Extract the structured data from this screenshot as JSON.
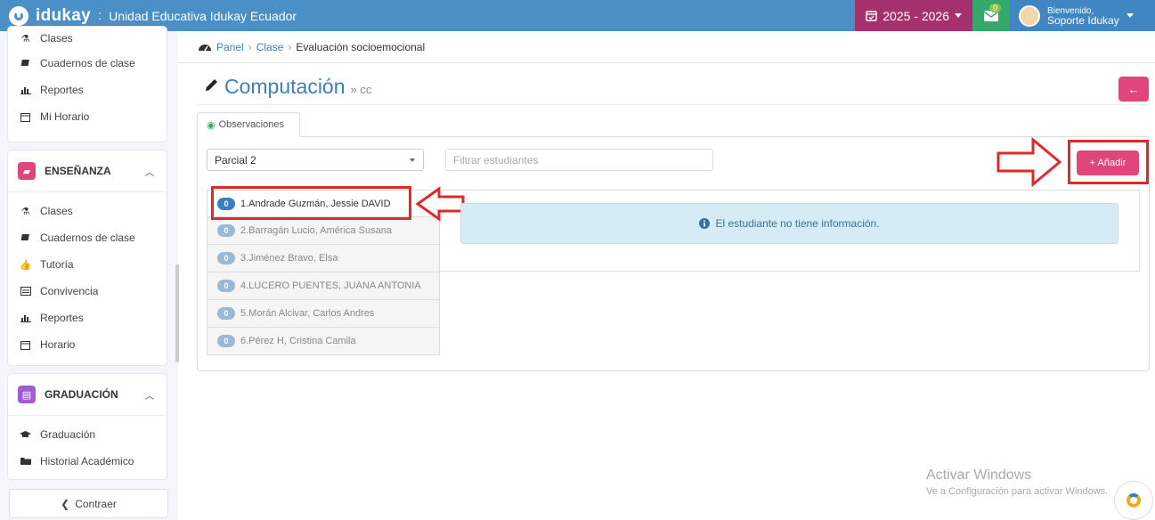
{
  "header": {
    "brand": "idukay",
    "separator": ":",
    "school": "Unidad Educativa Idukay Ecuador",
    "year": "2025 - 2026",
    "mail_count": "0",
    "welcome": "Bienvenido,",
    "user_name": "Soporte Idukay",
    "colors": {
      "bar": "#4a8fc6",
      "year": "#a5316e",
      "mail": "#35a96b"
    }
  },
  "sidebar": {
    "top_items": [
      {
        "label": "Clases",
        "icon": "flask-icon"
      },
      {
        "label": "Cuadernos de clase",
        "icon": "book-icon"
      },
      {
        "label": "Reportes",
        "icon": "bar-chart-icon"
      },
      {
        "label": "Mi Horario",
        "icon": "calendar-icon"
      }
    ],
    "sections": [
      {
        "title": "ENSEÑANZA",
        "color": "#e0467c",
        "items": [
          {
            "label": "Clases",
            "icon": "flask-icon"
          },
          {
            "label": "Cuadernos de clase",
            "icon": "book-icon"
          },
          {
            "label": "Tutoría",
            "icon": "thumbs-up-icon"
          },
          {
            "label": "Convivencia",
            "icon": "list-icon"
          },
          {
            "label": "Reportes",
            "icon": "bar-chart-icon"
          },
          {
            "label": "Horario",
            "icon": "calendar-icon"
          }
        ]
      },
      {
        "title": "GRADUACIÓN",
        "color": "#a25bd1",
        "items": [
          {
            "label": "Graduación",
            "icon": "graduation-cap-icon"
          },
          {
            "label": "Historial Académico",
            "icon": "folder-icon"
          }
        ]
      }
    ],
    "collapse_label": "Contraer"
  },
  "breadcrumb": {
    "root": "Panel",
    "mid": "Clase",
    "current": "Evaluación socioemocional"
  },
  "page": {
    "title": "Computación",
    "subtitle": "» cc"
  },
  "tab": {
    "label": "Observaciones"
  },
  "filters": {
    "period": "Parcial 2",
    "search_placeholder": "Filtrar estudiantes"
  },
  "add_button": "+ Añadir",
  "students": [
    {
      "count": "0",
      "name": "1.Andrade Guzmán, Jessie DAVID"
    },
    {
      "count": "0",
      "name": "2.Barragán Lucio, América Susana"
    },
    {
      "count": "0",
      "name": "3.Jiménez Bravo, Elsa"
    },
    {
      "count": "0",
      "name": "4.LUCERO PUENTES, JUANA ANTONIA"
    },
    {
      "count": "0",
      "name": "5.Morán Alcivar, Carlos Andres"
    },
    {
      "count": "0",
      "name": "6.Pérez H, Cristina Camila"
    }
  ],
  "info_message": "El estudiante no tiene información.",
  "watermark": {
    "line1": "Activar Windows",
    "line2": "Ve a Configuración para activar Windows."
  }
}
